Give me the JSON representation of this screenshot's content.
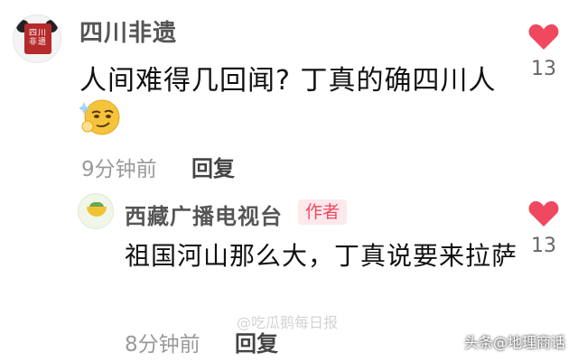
{
  "comment": {
    "username": "四川非遗",
    "text": "人间难得几回闻? 丁真的确四川人",
    "emoji": "smirk-emoji",
    "time": "9分钟前",
    "reply_label": "回复",
    "like_count": "13",
    "avatar_text": "四川非遗"
  },
  "reply": {
    "username": "西藏广播电视台",
    "author_badge": "作者",
    "text": "祖国河山那么大，丁真说要来拉萨",
    "time": "8分钟前",
    "reply_label": "回复",
    "like_count": "13"
  },
  "watermarks": {
    "center": "@吃瓜鹅每日报",
    "footer": "头条@地理商话"
  },
  "colors": {
    "heart": "#f0485f",
    "badge_bg": "#fde8ec",
    "badge_text": "#f0485f"
  }
}
